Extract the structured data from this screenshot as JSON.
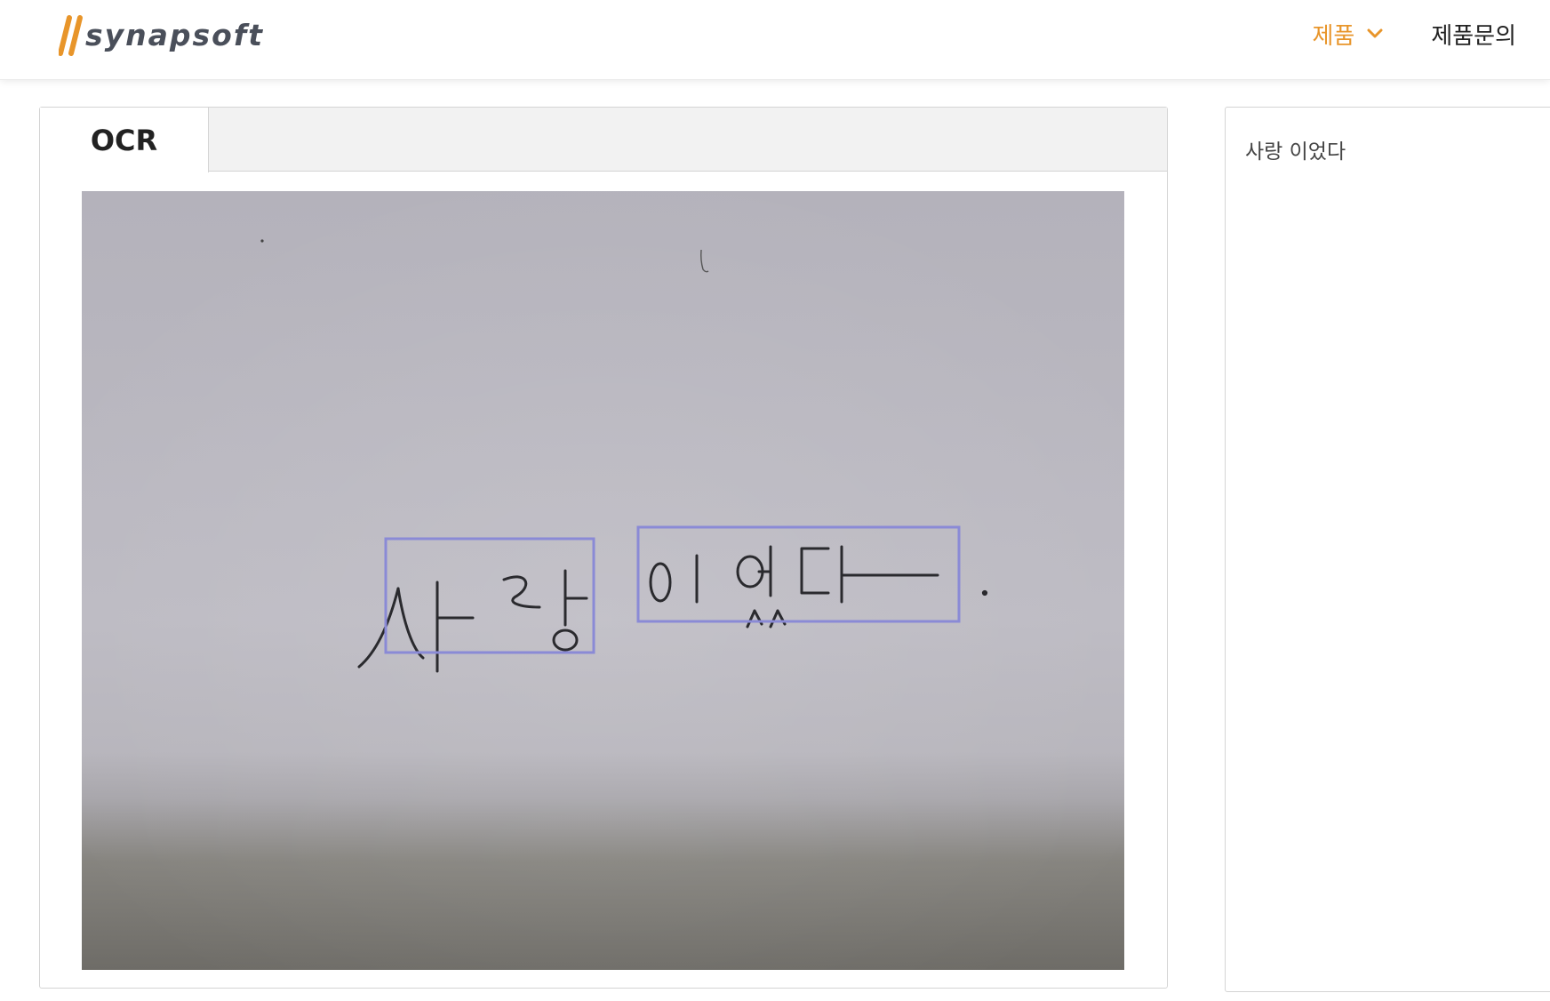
{
  "header": {
    "logo_text": "synapsoft",
    "nav": {
      "products_label": "제품",
      "inquiry_label": "제품문의"
    },
    "accent_color": "#e8952a"
  },
  "ocr_panel": {
    "tab_label": "OCR",
    "box_color": "#8a8ad6"
  },
  "result_panel": {
    "recognized_text": "사랑 이었다"
  }
}
